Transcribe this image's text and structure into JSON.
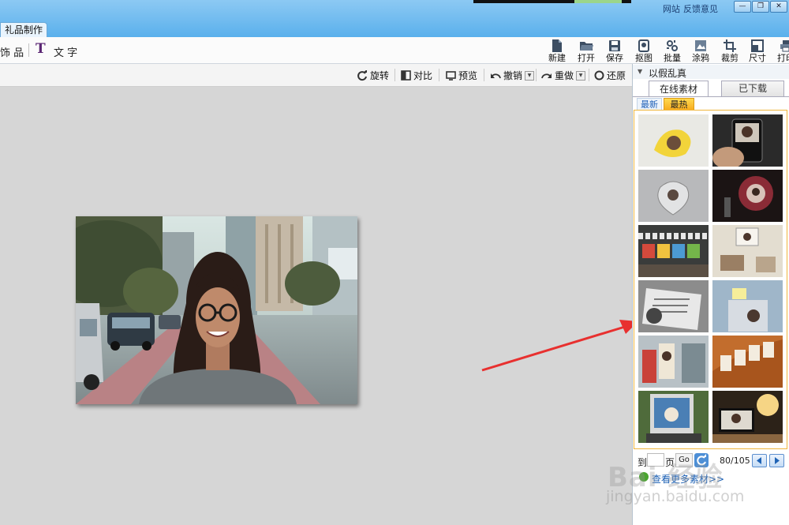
{
  "titlebar": {
    "links": [
      "网站",
      "反馈意见"
    ],
    "app_tab": "礼品制作"
  },
  "main_toolbar": {
    "decor_label": "饰 品",
    "text_label": "文 字",
    "buttons": [
      {
        "label": "新建",
        "icon": "new-file-icon"
      },
      {
        "label": "打开",
        "icon": "folder-icon"
      },
      {
        "label": "保存",
        "icon": "save-icon"
      },
      {
        "label": "抠图",
        "icon": "cutout-icon"
      },
      {
        "label": "批量",
        "icon": "batch-icon"
      },
      {
        "label": "涂鸦",
        "icon": "graffiti-icon"
      },
      {
        "label": "裁剪",
        "icon": "crop-icon"
      },
      {
        "label": "尺寸",
        "icon": "resize-icon"
      },
      {
        "label": "打印",
        "icon": "print-icon"
      }
    ]
  },
  "edit_toolbar": {
    "rotate": "旋转",
    "compare": "对比",
    "preview": "预览",
    "undo": "撤销",
    "redo": "重做",
    "restore": "还原"
  },
  "right_panel": {
    "title": "以假乱真",
    "tabs": [
      "在线素材",
      "已下载"
    ],
    "active_tab": "在线素材",
    "subtabs": [
      "最新",
      "最热"
    ],
    "active_subtab": "最热",
    "pager": {
      "goto": "到",
      "page": "页",
      "go": "Go",
      "count": "80/105"
    },
    "more_link": "查看更多素材>>"
  },
  "watermark": {
    "brand": "Bai 经验",
    "url": "jingyan.baidu.com"
  },
  "colors": {
    "titlebar": "#5ab0ec",
    "accent_orange": "#f7a91c",
    "arrow_red": "#e8302f"
  }
}
